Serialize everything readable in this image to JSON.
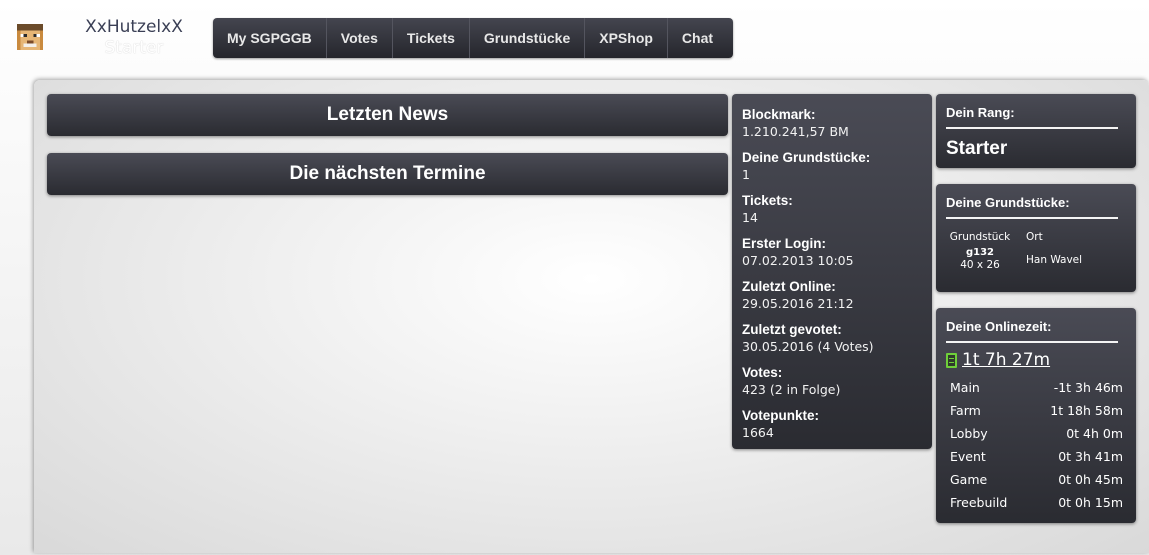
{
  "header": {
    "username": "XxHutzelxX",
    "rank": "Starter"
  },
  "nav": {
    "items": [
      {
        "label": "My SGPGGB"
      },
      {
        "label": "Votes"
      },
      {
        "label": "Tickets"
      },
      {
        "label": "Grundstücke"
      },
      {
        "label": "XPShop"
      },
      {
        "label": "Chat"
      }
    ]
  },
  "main": {
    "news_title": "Letzten News",
    "events_title": "Die nächsten Termine"
  },
  "stats": [
    {
      "label": "Blockmark:",
      "value": "1.210.241,57 BM"
    },
    {
      "label": "Deine Grundstücke:",
      "value": "1"
    },
    {
      "label": "Tickets:",
      "value": "14"
    },
    {
      "label": "Erster Login:",
      "value": "07.02.2013 10:05"
    },
    {
      "label": "Zuletzt Online:",
      "value": "29.05.2016 21:12"
    },
    {
      "label": "Zuletzt gevotet:",
      "value": "30.05.2016 (4 Votes)"
    },
    {
      "label": "Votes:",
      "value": "423 (2 in Folge)"
    },
    {
      "label": "Votepunkte:",
      "value": "1664"
    }
  ],
  "rank_box": {
    "title": "Dein Rang:",
    "rank": "Starter"
  },
  "plots_box": {
    "title": "Deine Grundstücke:",
    "col_plot": "Grundstück",
    "col_location": "Ort",
    "rows": [
      {
        "id": "g132",
        "size": "40 x 26",
        "location": "Han Wavel"
      }
    ]
  },
  "online_box": {
    "title": "Deine Onlinezeit:",
    "total": "1t 7h 27m",
    "rows": [
      {
        "server": "Main",
        "time": "-1t 3h 46m"
      },
      {
        "server": "Farm",
        "time": "1t 18h 58m"
      },
      {
        "server": "Lobby",
        "time": "0t 4h 0m"
      },
      {
        "server": "Event",
        "time": "0t 3h 41m"
      },
      {
        "server": "Game",
        "time": "0t 0h 45m"
      },
      {
        "server": "Freebuild",
        "time": "0t 0h 15m"
      }
    ]
  },
  "colors": {
    "panel_dark": "#2a2b31",
    "username": "#3a3f55",
    "icon_green": "#6fcf3a"
  }
}
